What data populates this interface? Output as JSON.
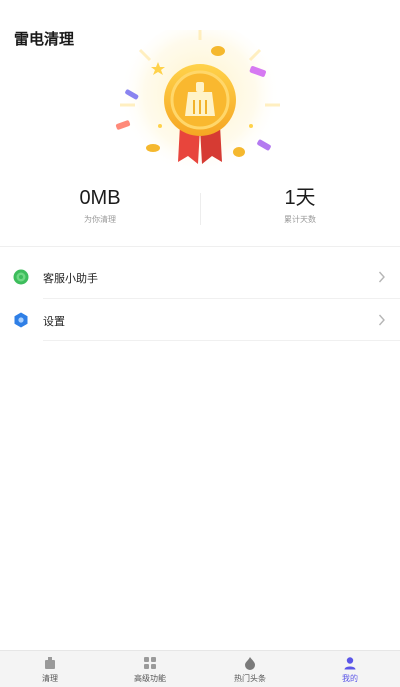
{
  "header": {
    "title": "雷电清理"
  },
  "stats": [
    {
      "value": "0MB",
      "label": "为你清理"
    },
    {
      "value": "1天",
      "label": "累计天数"
    }
  ],
  "menu": [
    {
      "label": "客服小助手",
      "icon": "chat-icon"
    },
    {
      "label": "设置",
      "icon": "settings-icon"
    }
  ],
  "tabs": [
    {
      "label": "清理",
      "icon": "clean-icon"
    },
    {
      "label": "高级功能",
      "icon": "apps-icon"
    },
    {
      "label": "热门头条",
      "icon": "flame-icon"
    },
    {
      "label": "我的",
      "icon": "user-icon"
    }
  ],
  "colors": {
    "accent": "#5b56e8",
    "medal_gold": "#f7b731",
    "ribbon_red": "#e8453c"
  }
}
